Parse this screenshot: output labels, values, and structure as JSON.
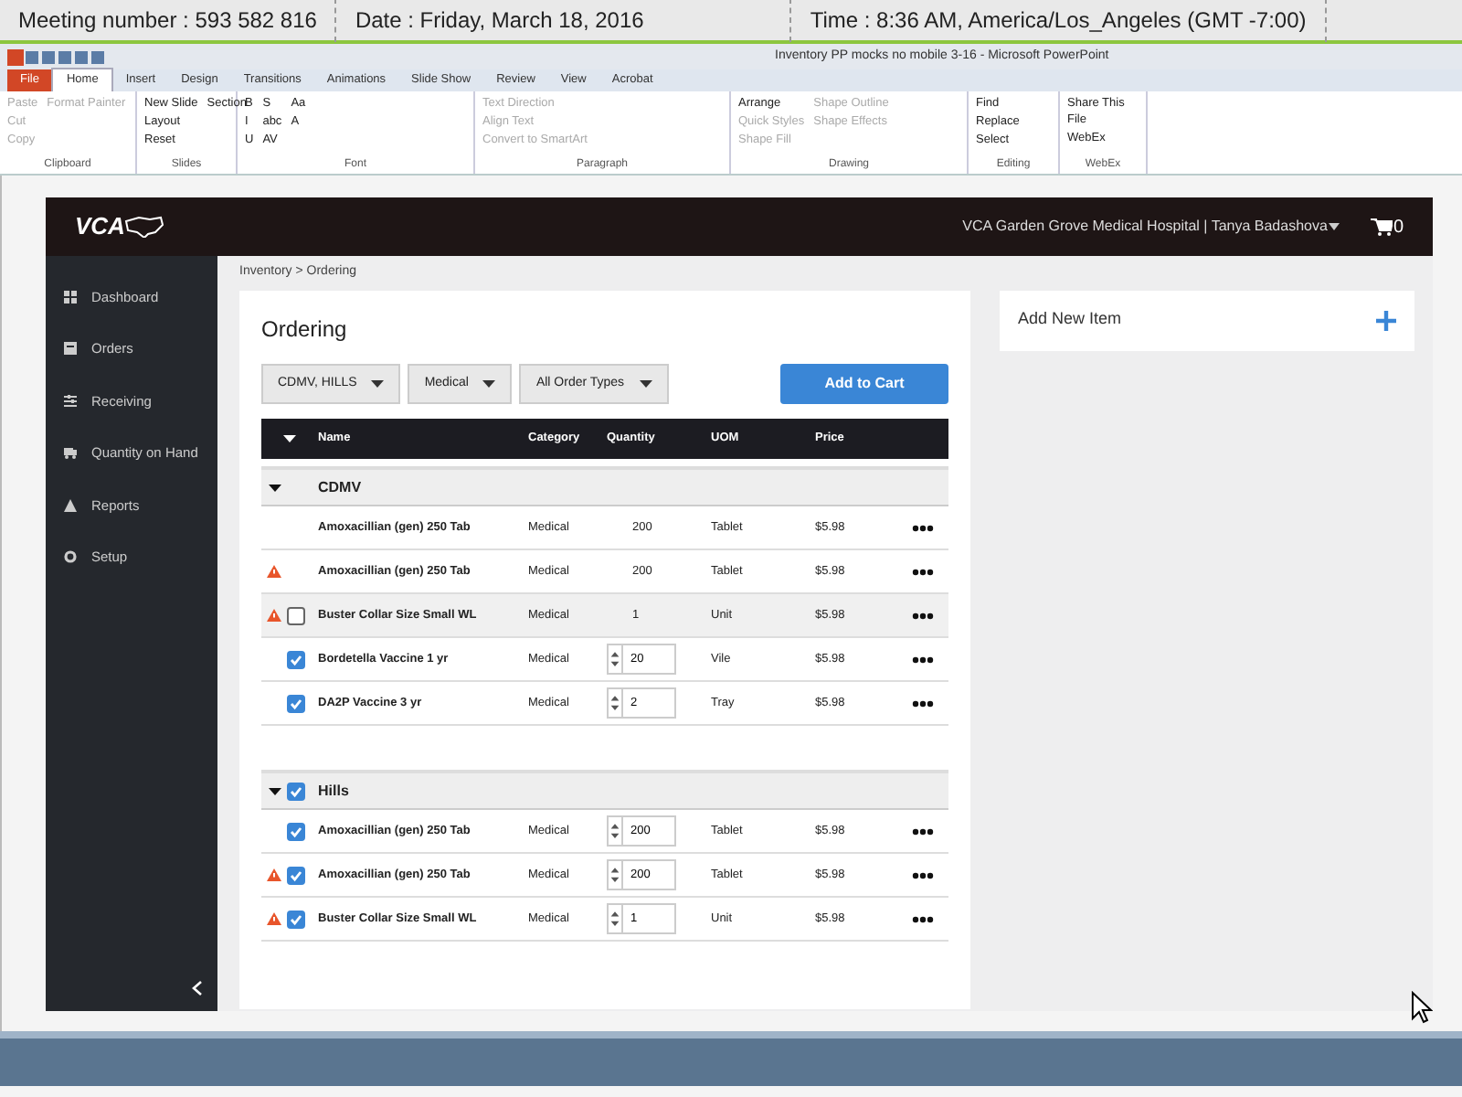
{
  "meeting_bar": {
    "meeting_number": "Meeting number : 593 582 816",
    "date": "Date : Friday, March 18, 2016",
    "time": "Time : 8:36 AM, America/Los_Angeles (GMT -7:00)"
  },
  "window": {
    "title": "Inventory PP mocks no mobile 3-16  -  Microsoft PowerPoint"
  },
  "ribbon": {
    "tabs": [
      {
        "label": "File",
        "selected": false
      },
      {
        "label": "Home",
        "selected": true
      },
      {
        "label": "Insert",
        "selected": false
      },
      {
        "label": "Design",
        "selected": false
      },
      {
        "label": "Transitions",
        "selected": false
      },
      {
        "label": "Animations",
        "selected": false
      },
      {
        "label": "Slide Show",
        "selected": false
      },
      {
        "label": "Review",
        "selected": false
      },
      {
        "label": "View",
        "selected": false
      },
      {
        "label": "Acrobat",
        "selected": false
      }
    ],
    "groups": [
      {
        "label": "Clipboard",
        "items": [
          {
            "label": "Paste",
            "disabled": true
          },
          {
            "label": "Cut",
            "disabled": true
          },
          {
            "label": "Copy",
            "disabled": true
          },
          {
            "label": "Format Painter",
            "disabled": true
          }
        ]
      },
      {
        "label": "Slides",
        "items": [
          {
            "label": "New Slide",
            "disabled": false
          },
          {
            "label": "Layout",
            "disabled": false
          },
          {
            "label": "Reset",
            "disabled": false
          },
          {
            "label": "Section",
            "disabled": false
          }
        ]
      },
      {
        "label": "Font",
        "items": [
          {
            "label": "B",
            "disabled": false
          },
          {
            "label": "I",
            "disabled": false
          },
          {
            "label": "U",
            "disabled": false
          },
          {
            "label": "S",
            "disabled": false
          },
          {
            "label": "abc",
            "disabled": false
          },
          {
            "label": "AV",
            "disabled": false
          },
          {
            "label": "Aa",
            "disabled": false
          },
          {
            "label": "A",
            "disabled": false
          }
        ]
      },
      {
        "label": "Paragraph",
        "items": [
          {
            "label": "Text Direction",
            "disabled": true
          },
          {
            "label": "Align Text",
            "disabled": true
          },
          {
            "label": "Convert to SmartArt",
            "disabled": true
          }
        ]
      },
      {
        "label": "Drawing",
        "items": [
          {
            "label": "Arrange",
            "disabled": false
          },
          {
            "label": "Quick Styles",
            "disabled": true
          },
          {
            "label": "Shape Fill",
            "disabled": true
          },
          {
            "label": "Shape Outline",
            "disabled": true
          },
          {
            "label": "Shape Effects",
            "disabled": true
          }
        ]
      },
      {
        "label": "Editing",
        "items": [
          {
            "label": "Find",
            "disabled": false
          },
          {
            "label": "Replace",
            "disabled": false
          },
          {
            "label": "Select",
            "disabled": false
          }
        ]
      },
      {
        "label": "WebEx",
        "items": [
          {
            "label": "Share This File",
            "disabled": false
          },
          {
            "label": "WebEx",
            "disabled": false
          }
        ]
      }
    ]
  },
  "app": {
    "logo": "VCA",
    "hospital_user": "VCA Garden Grove Medical Hospital | Tanya Badashova",
    "cart_count": "0",
    "sidebar": {
      "items": [
        {
          "label": "Dashboard"
        },
        {
          "label": "Orders"
        },
        {
          "label": "Receiving"
        },
        {
          "label": "Quantity on Hand"
        },
        {
          "label": "Reports"
        },
        {
          "label": "Setup"
        }
      ]
    },
    "breadcrumb": "Inventory > Ordering",
    "heading": "Ordering",
    "filters": [
      "CDMV, HILLS",
      "Medical",
      "All Order Types"
    ],
    "add_to_cart": "Add to Cart",
    "add_new_item": "Add New Item",
    "table": {
      "columns": [
        "Name",
        "Category",
        "Quantity",
        "UOM",
        "Price"
      ],
      "groups": [
        {
          "name": "CDMV",
          "expanded": true,
          "rows": [
            {
              "kind": "plain",
              "warning": false,
              "name": "Amoxacillian (gen) 250 Tab",
              "category": "Medical",
              "quantity": "200",
              "uom": "Tablet",
              "price": "$5.98"
            },
            {
              "kind": "plain",
              "warning": true,
              "name": "Amoxacillian (gen) 250 Tab",
              "category": "Medical",
              "quantity": "200",
              "uom": "Tablet",
              "price": "$5.98"
            },
            {
              "kind": "selectable",
              "checked": false,
              "warning": true,
              "name": "Buster Collar Size Small WL",
              "category": "Medical",
              "quantity": "1",
              "uom": "Unit",
              "price": "$5.98"
            },
            {
              "kind": "selectable",
              "checked": true,
              "warning": false,
              "name": "Bordetella Vaccine 1 yr",
              "category": "Medical",
              "quantity": "20",
              "uom": "Vile",
              "price": "$5.98"
            },
            {
              "kind": "selectable",
              "checked": true,
              "warning": false,
              "name": "DA2P Vaccine 3 yr",
              "category": "Medical",
              "quantity": "2",
              "uom": "Tray",
              "price": "$5.98"
            }
          ]
        },
        {
          "name": "Hills",
          "checked": true,
          "expanded": true,
          "rows": [
            {
              "kind": "selectable",
              "checked": true,
              "warning": false,
              "name": "Amoxacillian (gen) 250 Tab",
              "category": "Medical",
              "quantity": "200",
              "uom": "Tablet",
              "price": "$5.98"
            },
            {
              "kind": "selectable",
              "checked": true,
              "warning": true,
              "name": "Amoxacillian (gen) 250 Tab",
              "category": "Medical",
              "quantity": "200",
              "uom": "Tablet",
              "price": "$5.98"
            },
            {
              "kind": "selectable",
              "checked": true,
              "warning": true,
              "name": "Buster Collar Size Small WL",
              "category": "Medical",
              "quantity": "1",
              "uom": "Unit",
              "price": "$5.98"
            }
          ]
        }
      ]
    }
  }
}
